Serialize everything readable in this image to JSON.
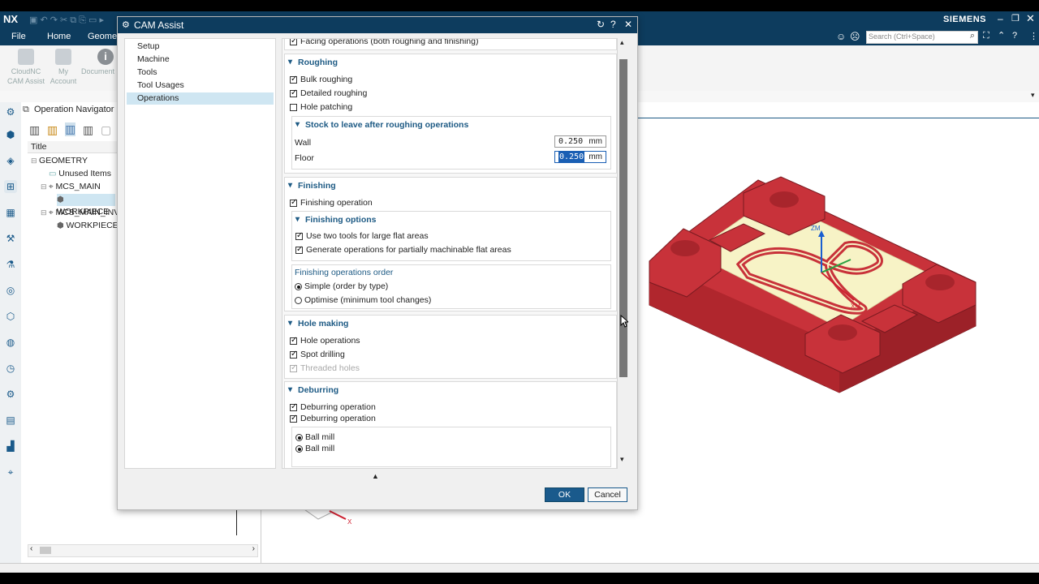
{
  "app": {
    "logo": "NX",
    "brand": "SIEMENS",
    "search_placeholder": "Search (Ctrl+Space)"
  },
  "menu": {
    "items": [
      "File",
      "Home",
      "Geomet"
    ]
  },
  "ribbon": {
    "buttons": [
      {
        "label": "CloudNC\nCAM Assist",
        "line1": "CloudNC",
        "line2": "CAM Assist",
        "icon": "cloudnc-icon"
      },
      {
        "line1": "My",
        "line2": "Account",
        "icon": "account-icon"
      },
      {
        "line1": "Document",
        "line2": "",
        "icon": "info-icon"
      }
    ]
  },
  "navigator": {
    "title": "Operation Navigator",
    "column_title": "Title",
    "tree": [
      {
        "label": "GEOMETRY",
        "level": 0
      },
      {
        "label": "Unused Items",
        "level": 1
      },
      {
        "label": "MCS_MAIN",
        "level": 1
      },
      {
        "label": "WORKPIECE",
        "level": 2,
        "selected": true
      },
      {
        "label": "MCS_MAIN_INV",
        "level": 1
      },
      {
        "label": "WORKPIECE_",
        "level": 2
      }
    ]
  },
  "dialog": {
    "title": "CAM Assist",
    "tree": [
      {
        "label": "Setup"
      },
      {
        "label": "Machine"
      },
      {
        "label": "Tools"
      },
      {
        "label": "Tool Usages"
      },
      {
        "label": "Operations",
        "selected": true
      }
    ],
    "top_option": "Facing operations (both roughing and finishing)",
    "roughing": {
      "header": "Roughing",
      "bulk": {
        "label": "Bulk roughing",
        "checked": true
      },
      "detailed": {
        "label": "Detailed roughing",
        "checked": true
      },
      "hole_patching": {
        "label": "Hole patching",
        "checked": false
      },
      "stock": {
        "header": "Stock to leave after roughing operations",
        "wall_label": "Wall",
        "wall_value": "0.250",
        "floor_label": "Floor",
        "floor_value": "0.250",
        "unit": "mm"
      }
    },
    "finishing": {
      "header": "Finishing",
      "operation": {
        "label": "Finishing operation",
        "checked": true
      },
      "options_header": "Finishing options",
      "two_tools": {
        "label": "Use two tools for large flat areas",
        "checked": true
      },
      "partial": {
        "label": "Generate operations for partially machinable flat areas",
        "checked": true
      },
      "order_label": "Finishing operations order",
      "simple": {
        "label": "Simple (order by type)",
        "selected": true
      },
      "optimise": {
        "label": "Optimise (minimum tool changes)",
        "selected": false
      }
    },
    "hole_making": {
      "header": "Hole making",
      "operations": {
        "label": "Hole operations",
        "checked": true
      },
      "spot": {
        "label": "Spot drilling",
        "checked": true
      },
      "threaded": {
        "label": "Threaded holes",
        "checked": true,
        "disabled": true
      }
    },
    "deburring": {
      "header": "Deburring",
      "op1": {
        "label": "Deburring operation",
        "checked": true
      },
      "op2": {
        "label": "Deburring operation",
        "checked": true
      },
      "ball1": {
        "label": "Ball mill",
        "selected": true
      },
      "ball2": {
        "label": "Ball mill",
        "selected": true
      }
    },
    "ok": "OK",
    "cancel": "Cancel"
  },
  "viewport": {
    "axis_labels": [
      "ZM",
      "XM",
      "X"
    ],
    "part_color": "#c8323a",
    "floor_color": "#f7f3c6"
  },
  "colors": {
    "titlebar": "#0d3c5e",
    "accent": "#1d5a84"
  }
}
